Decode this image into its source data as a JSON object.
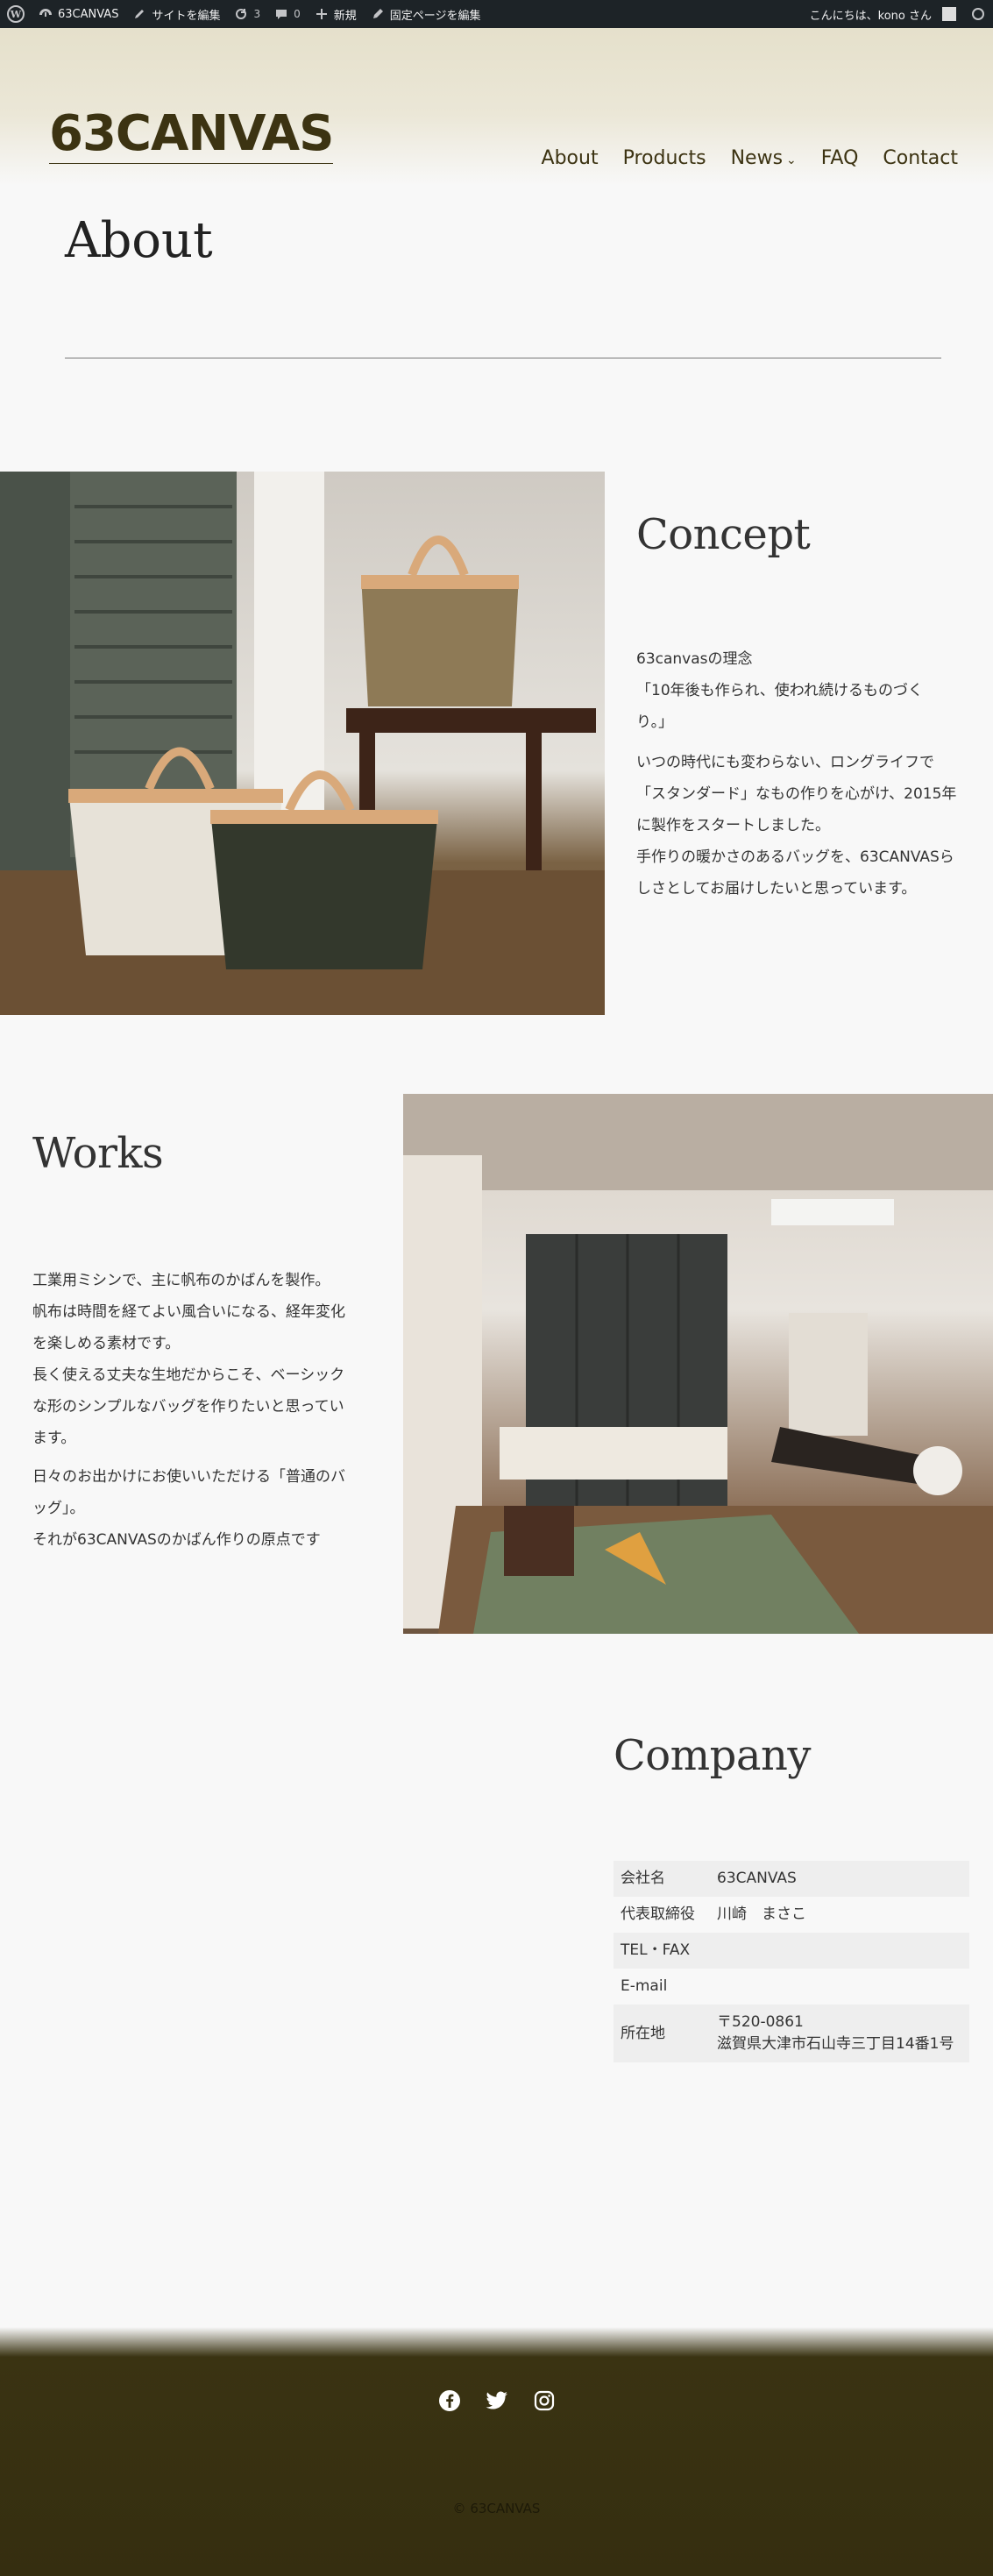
{
  "admin_bar": {
    "site_name": "63CANVAS",
    "customize": "サイトを編集",
    "updates_count": "3",
    "comments_count": "0",
    "new": "新規",
    "edit_page": "固定ページを編集",
    "greeting": "こんにちは、kono さん"
  },
  "header": {
    "logo": "63CANVAS",
    "nav": [
      "About",
      "Products",
      "News",
      "FAQ",
      "Contact"
    ]
  },
  "page_title": "About",
  "concept": {
    "heading": "Concept",
    "lines": [
      "63canvasの理念",
      "「10年後も作られ、使われ続けるものづく",
      "り。」",
      "いつの時代にも変わらない、ロングライフで",
      "「スタンダード」なもの作りを心がけ、2015年",
      "に製作をスタートしました。",
      "手作りの暖かさのあるバッグを、63CANVASら",
      "しさとしてお届けしたいと思っています。"
    ]
  },
  "works": {
    "heading": "Works",
    "lines": [
      "工業用ミシンで、主に帆布のかばんを製作。",
      "帆布は時間を経てよい風合いになる、経年変化",
      "を楽しめる素材です。",
      "長く使える丈夫な生地だからこそ、ベーシック",
      "な形のシンプルなバッグを作りたいと思ってい",
      "ます。",
      "日々のお出かけにお使いいただける「普通のバ",
      "ッグ」。",
      "それが63CANVASのかばん作りの原点です"
    ]
  },
  "company": {
    "heading": "Company",
    "rows": [
      {
        "key": "会社名",
        "value": "63CANVAS",
        "value2": ""
      },
      {
        "key": "代表取締役",
        "value": "川崎　まさこ",
        "value2": ""
      },
      {
        "key": "TEL・FAX",
        "value": "",
        "value2": ""
      },
      {
        "key": "E-mail",
        "value": "",
        "value2": ""
      },
      {
        "key": "所在地",
        "value": "〒520-0861",
        "value2": "滋賀県大津市石山寺三丁目14番1号"
      }
    ]
  },
  "footer": {
    "social": [
      "facebook-icon",
      "twitter-icon",
      "instagram-icon"
    ],
    "copyright": "© 63CANVAS"
  },
  "colors": {
    "brand": "#3c3312",
    "footer_bg": "#352e10",
    "admin_bar": "#1d2327"
  }
}
